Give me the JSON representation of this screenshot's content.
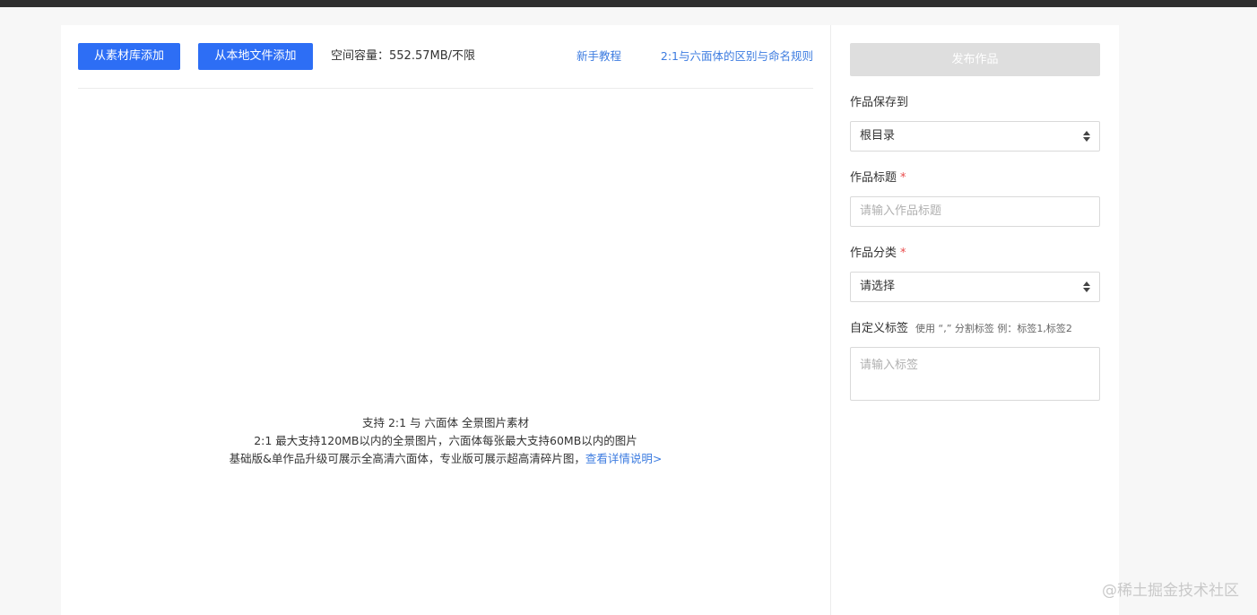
{
  "toolbar": {
    "add_from_library": "从素材库添加",
    "add_from_local": "从本地文件添加",
    "capacity": "空间容量：552.57MB/不限",
    "tutorial_link": "新手教程",
    "rules_link": "2:1与六面体的区别与命名规则"
  },
  "dropzone": {
    "line1": "支持 2:1 与 六面体 全景图片素材",
    "line2": "2:1 最大支持120MB以内的全景图片，六面体每张最大支持60MB以内的图片",
    "line3": "基础版&单作品升级可展示全高清六面体，专业版可展示超高清碎片图，",
    "detail_link": "查看详情说明>"
  },
  "sidebar": {
    "publish_button": "发布作品",
    "save_to": {
      "label": "作品保存到",
      "value": "根目录"
    },
    "title": {
      "label": "作品标题",
      "required_mark": "*",
      "placeholder": "请输入作品标题"
    },
    "category": {
      "label": "作品分类",
      "required_mark": "*",
      "value": "请选择"
    },
    "tags": {
      "label": "自定义标签",
      "hint": "使用 “,” 分割标签 例：标签1,标签2",
      "placeholder": "请输入标签"
    }
  },
  "watermark": "@稀土掘金技术社区",
  "colors": {
    "primary": "#2d6ef5",
    "link": "#3d7ce0",
    "required": "#e94b4b",
    "disabled_button": "#dedede",
    "top_bar": "#2f2f2f"
  }
}
